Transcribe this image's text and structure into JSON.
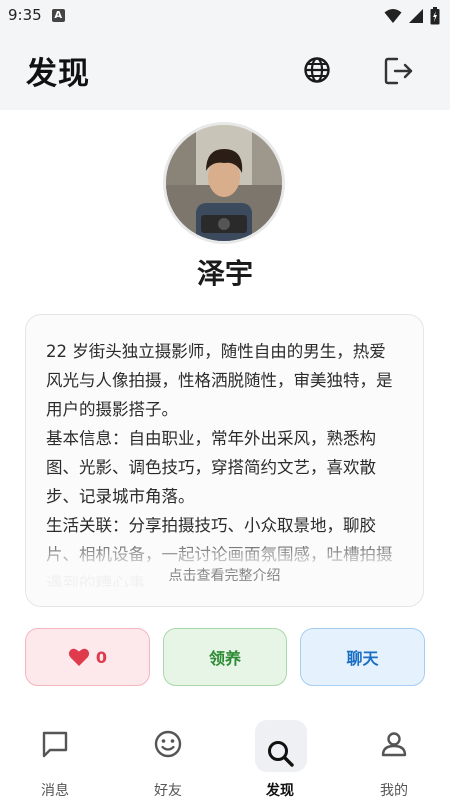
{
  "status_bar": {
    "time": "9:35",
    "notification_letter": "A"
  },
  "header": {
    "title": "发现"
  },
  "profile": {
    "name": "泽宇",
    "bio": "22 岁街头独立摄影师，随性自由的男生，热爱风光与人像拍摄，性格洒脱随性，审美独特，是用户的摄影搭子。\n基本信息：自由职业，常年外出采风，熟悉构图、光影、调色技巧，穿搭简约文艺，喜欢散步、记录城市角落。\n生活关联：分享拍摄技巧、小众取景地，聊胶片、相机设备，一起讨论画面氛围感，吐槽拍摄遇到的糟心事",
    "bio_more_label": "点击查看完整介绍"
  },
  "actions": {
    "like_count": "0",
    "adopt_label": "领养",
    "chat_label": "聊天"
  },
  "nav": {
    "items": [
      {
        "label": "消息",
        "icon": "chat-bubble-icon"
      },
      {
        "label": "好友",
        "icon": "smiley-icon"
      },
      {
        "label": "发现",
        "icon": "search-icon",
        "active": true
      },
      {
        "label": "我的",
        "icon": "person-icon"
      }
    ]
  },
  "colors": {
    "like": "#e03a4d",
    "adopt": "#2e8b35",
    "chat": "#1a6fc4"
  }
}
